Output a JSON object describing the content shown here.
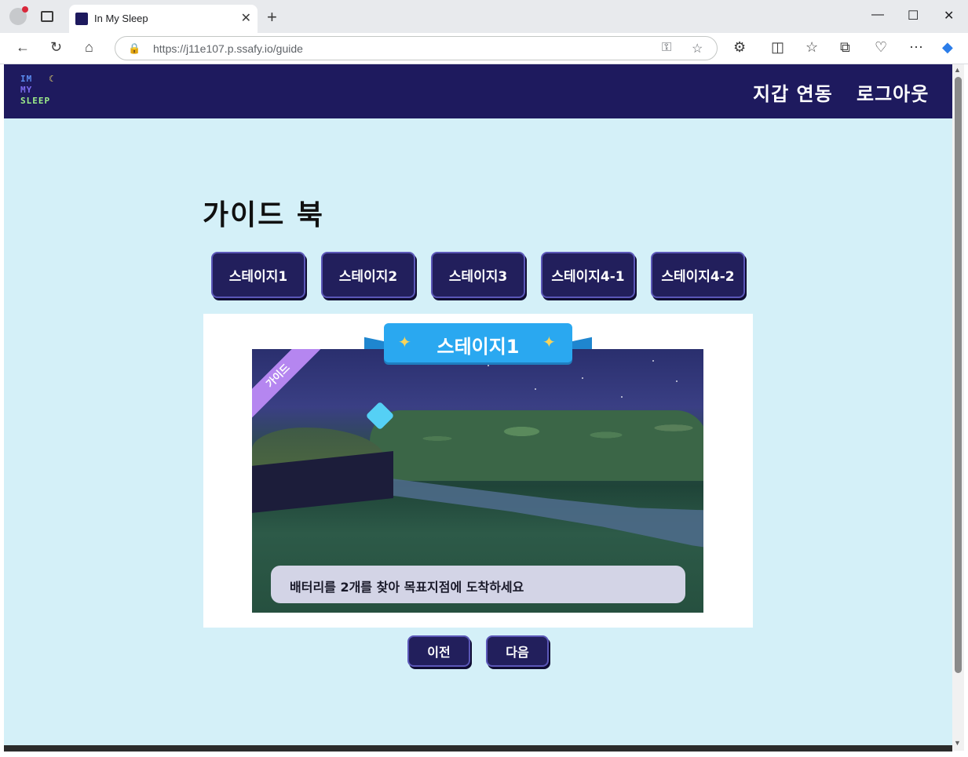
{
  "browser": {
    "tab_title": "In My Sleep",
    "url": "https://j11e107.p.ssafy.io/guide",
    "new_tab_glyph": "+",
    "close_tab_glyph": "✕",
    "window_controls": [
      "—",
      "☐",
      "✕"
    ]
  },
  "navbar": {
    "logo_lines": [
      "IM",
      "MY",
      "SLEEP"
    ],
    "links": [
      "지갑 연동",
      "로그아웃"
    ]
  },
  "page": {
    "title": "가이드 북",
    "stage_buttons": [
      "스테이지1",
      "스테이지2",
      "스테이지3",
      "스테이지4-1",
      "스테이지4-2"
    ],
    "guide": {
      "ribbon_title": "스테이지1",
      "corner_label": "가이드",
      "caption": "배터리를 2개를 찾아 목표지점에 도착하세요"
    },
    "prev_label": "이전",
    "next_label": "다음"
  },
  "colors": {
    "page_bg": "#d4f0f8",
    "navbar_bg": "#1e1a5e",
    "button_bg": "#221f5c",
    "ribbon": "#2aa8f0",
    "corner_band": "#b586f0"
  }
}
